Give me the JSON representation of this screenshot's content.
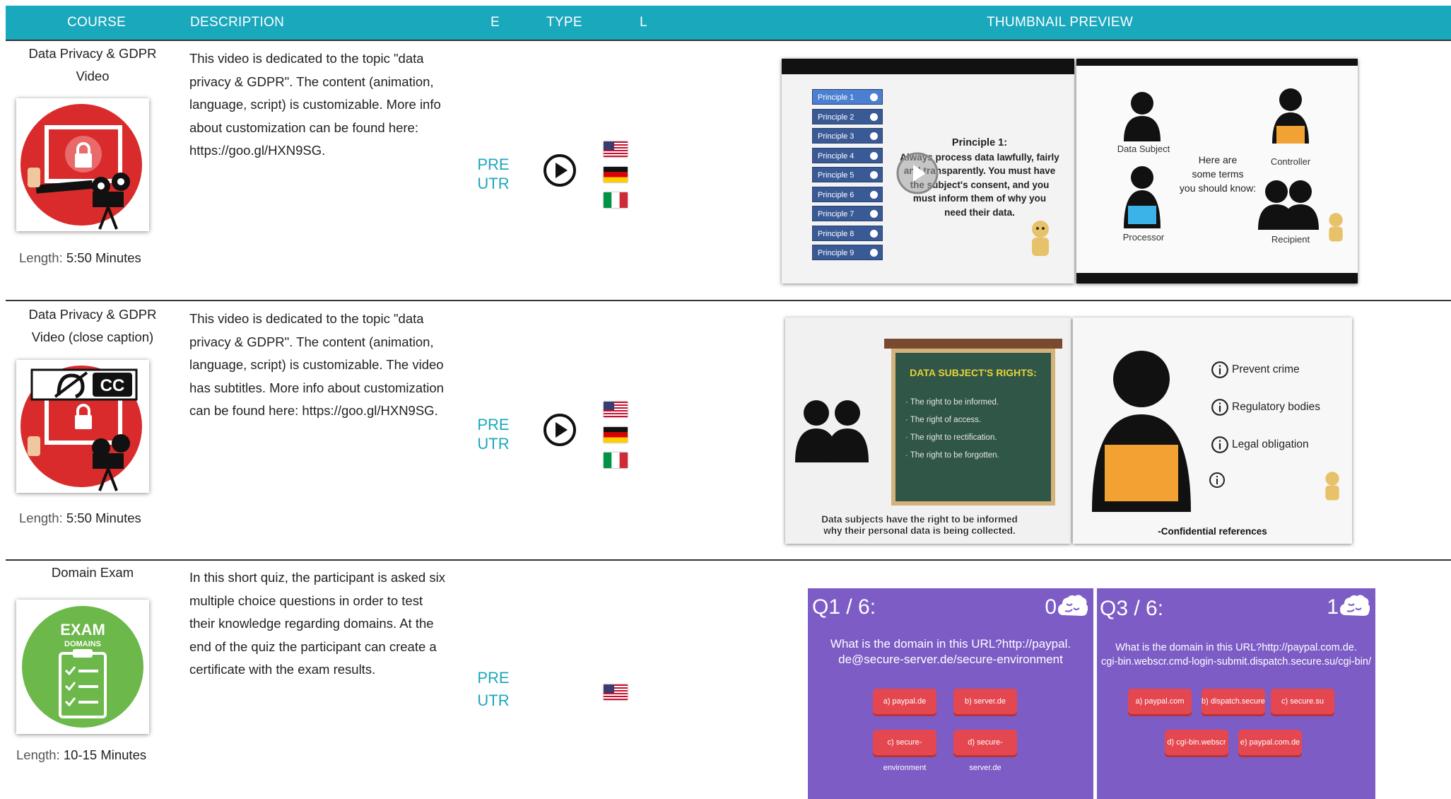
{
  "header": {
    "course": "COURSE",
    "description": "DESCRIPTION",
    "e": "E",
    "type": "TYPE",
    "l": "L",
    "thumbnail_preview": "THUMBNAIL PREVIEW"
  },
  "colors": {
    "header_bg": "#1aa8bc",
    "accent": "#1aa8bc",
    "quiz_purple": "#7d5cc6",
    "quiz_button": "#e4474f"
  },
  "rows": [
    {
      "title_line1": "Data Privacy & GDPR",
      "title_line2": "Video",
      "length_label": "Length:",
      "length_value": "5:50 Minutes",
      "description": "This video is dedicated to the topic \"data privacy & GDPR\". The content (animation, language, script) is customizable. More info about customization can be found here: https://goo.gl/HXN9SG.",
      "type_line1": "PRE",
      "type_line2": "UTR",
      "icon": "play-circle-icon",
      "flags": [
        "us-flag-icon",
        "de-flag-icon",
        "it-flag-icon"
      ],
      "preview": {
        "principles": [
          "Principle 1",
          "Principle 2",
          "Principle 3",
          "Principle 4",
          "Principle 5",
          "Principle 6",
          "Principle 7",
          "Principle 8",
          "Principle 9"
        ],
        "principle_heading": "Principle 1:",
        "principle_text": [
          "Always process data lawfully, fairly",
          "and transparently. You must have",
          "the subject's consent, and you",
          "must inform them of why you",
          "need their data."
        ],
        "terms": {
          "data_subject": "Data Subject",
          "controller": "Controller",
          "processor": "Processor",
          "recipient": "Recipient",
          "center_text": [
            "Here are",
            "some terms",
            "you should know:"
          ]
        }
      }
    },
    {
      "title_line1": "Data Privacy & GDPR",
      "title_line2": "Video (close caption)",
      "length_label": "Length:",
      "length_value": "5:50 Minutes",
      "description": "This video is dedicated to the topic \"data privacy & GDPR\". The content (animation, language, script) is customizable. The video has subtitles. More info about customization can be found here: https://goo.gl/HXN9SG.",
      "type_line1": "PRE",
      "type_line2": "UTR",
      "icon": "play-circle-icon",
      "flags": [
        "us-flag-icon",
        "de-flag-icon",
        "it-flag-icon"
      ],
      "preview": {
        "board_title": "DATA SUBJECT'S RIGHTS:",
        "board_items": [
          "· The right to be informed.",
          "· The right of access.",
          "· The right to rectification.",
          "· The right to be forgotten."
        ],
        "caption_left": [
          "Data subjects have the right to be informed",
          "why their personal data is being collected."
        ],
        "reasons": [
          "Prevent crime",
          "Regulatory bodies",
          "Legal obligation"
        ],
        "caption_right": "-Confidential references"
      }
    },
    {
      "title_line1": "Domain Exam",
      "length_label": "Length:",
      "length_value": "10-15 Minutes",
      "description": "In this short quiz, the participant is asked six multiple choice questions in order to test their knowledge regarding domains. At the end of the quiz the participant can create a certificate with the exam results.",
      "type_line1": "PRE",
      "type_line2": "UTR",
      "flags": [
        "us-flag-icon"
      ],
      "exam_badge": {
        "title": "EXAM",
        "subtitle": "DOMAINS"
      },
      "preview": {
        "q1": {
          "counter": "Q1 / 6:",
          "score": "0",
          "question": [
            "What is the domain in this URL?http://paypal.",
            "de@secure-server.de/secure-environment"
          ],
          "answers": [
            "a) paypal.de",
            "b) server.de",
            "c) secure-environment",
            "d) secure-server.de"
          ]
        },
        "q3": {
          "counter": "Q3 / 6:",
          "score": "1",
          "question": [
            "What is the domain in this URL?http://paypal.com.de.",
            "cgi-bin.webscr.cmd-login-submit.dispatch.secure.su/cgi-bin/"
          ],
          "answers": [
            "a) paypal.com",
            "b) dispatch.secure",
            "c) secure.su",
            "d) cgi-bin.webscr",
            "e) paypal.com.de"
          ]
        }
      }
    }
  ]
}
